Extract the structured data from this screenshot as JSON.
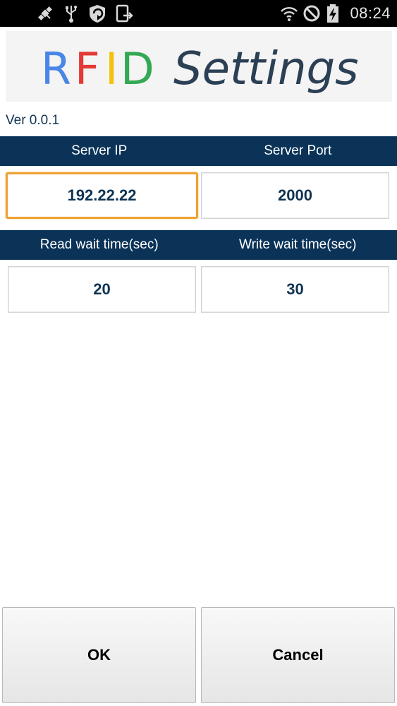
{
  "status_bar": {
    "time": "08:24",
    "left_icons": [
      "satellite-icon",
      "usb-icon",
      "shield-icon",
      "phone-transfer-icon"
    ],
    "right_icons": [
      "wifi-icon",
      "blocked-icon",
      "battery-charging-icon"
    ]
  },
  "banner": {
    "rfid_letters": [
      {
        "char": "R",
        "color": "#4a86e8"
      },
      {
        "char": "F",
        "color": "#e53935"
      },
      {
        "char": "I",
        "color": "#f4c20d"
      },
      {
        "char": "D",
        "color": "#34a853"
      }
    ],
    "settings_text": "Settings",
    "settings_color": "#2b3f55"
  },
  "version": "Ver 0.0.1",
  "server": {
    "ip_label": "Server IP",
    "port_label": "Server Port",
    "ip_value": "192.22.22",
    "port_value": "2000"
  },
  "timing": {
    "read_label": "Read wait time(sec)",
    "write_label": "Write wait time(sec)",
    "read_value": "20",
    "write_value": "30"
  },
  "actions": {
    "ok_label": "OK",
    "cancel_label": "Cancel"
  },
  "colors": {
    "header_bg": "#0b3358",
    "focus_border": "#f0a030",
    "value_text": "#0f3352"
  }
}
